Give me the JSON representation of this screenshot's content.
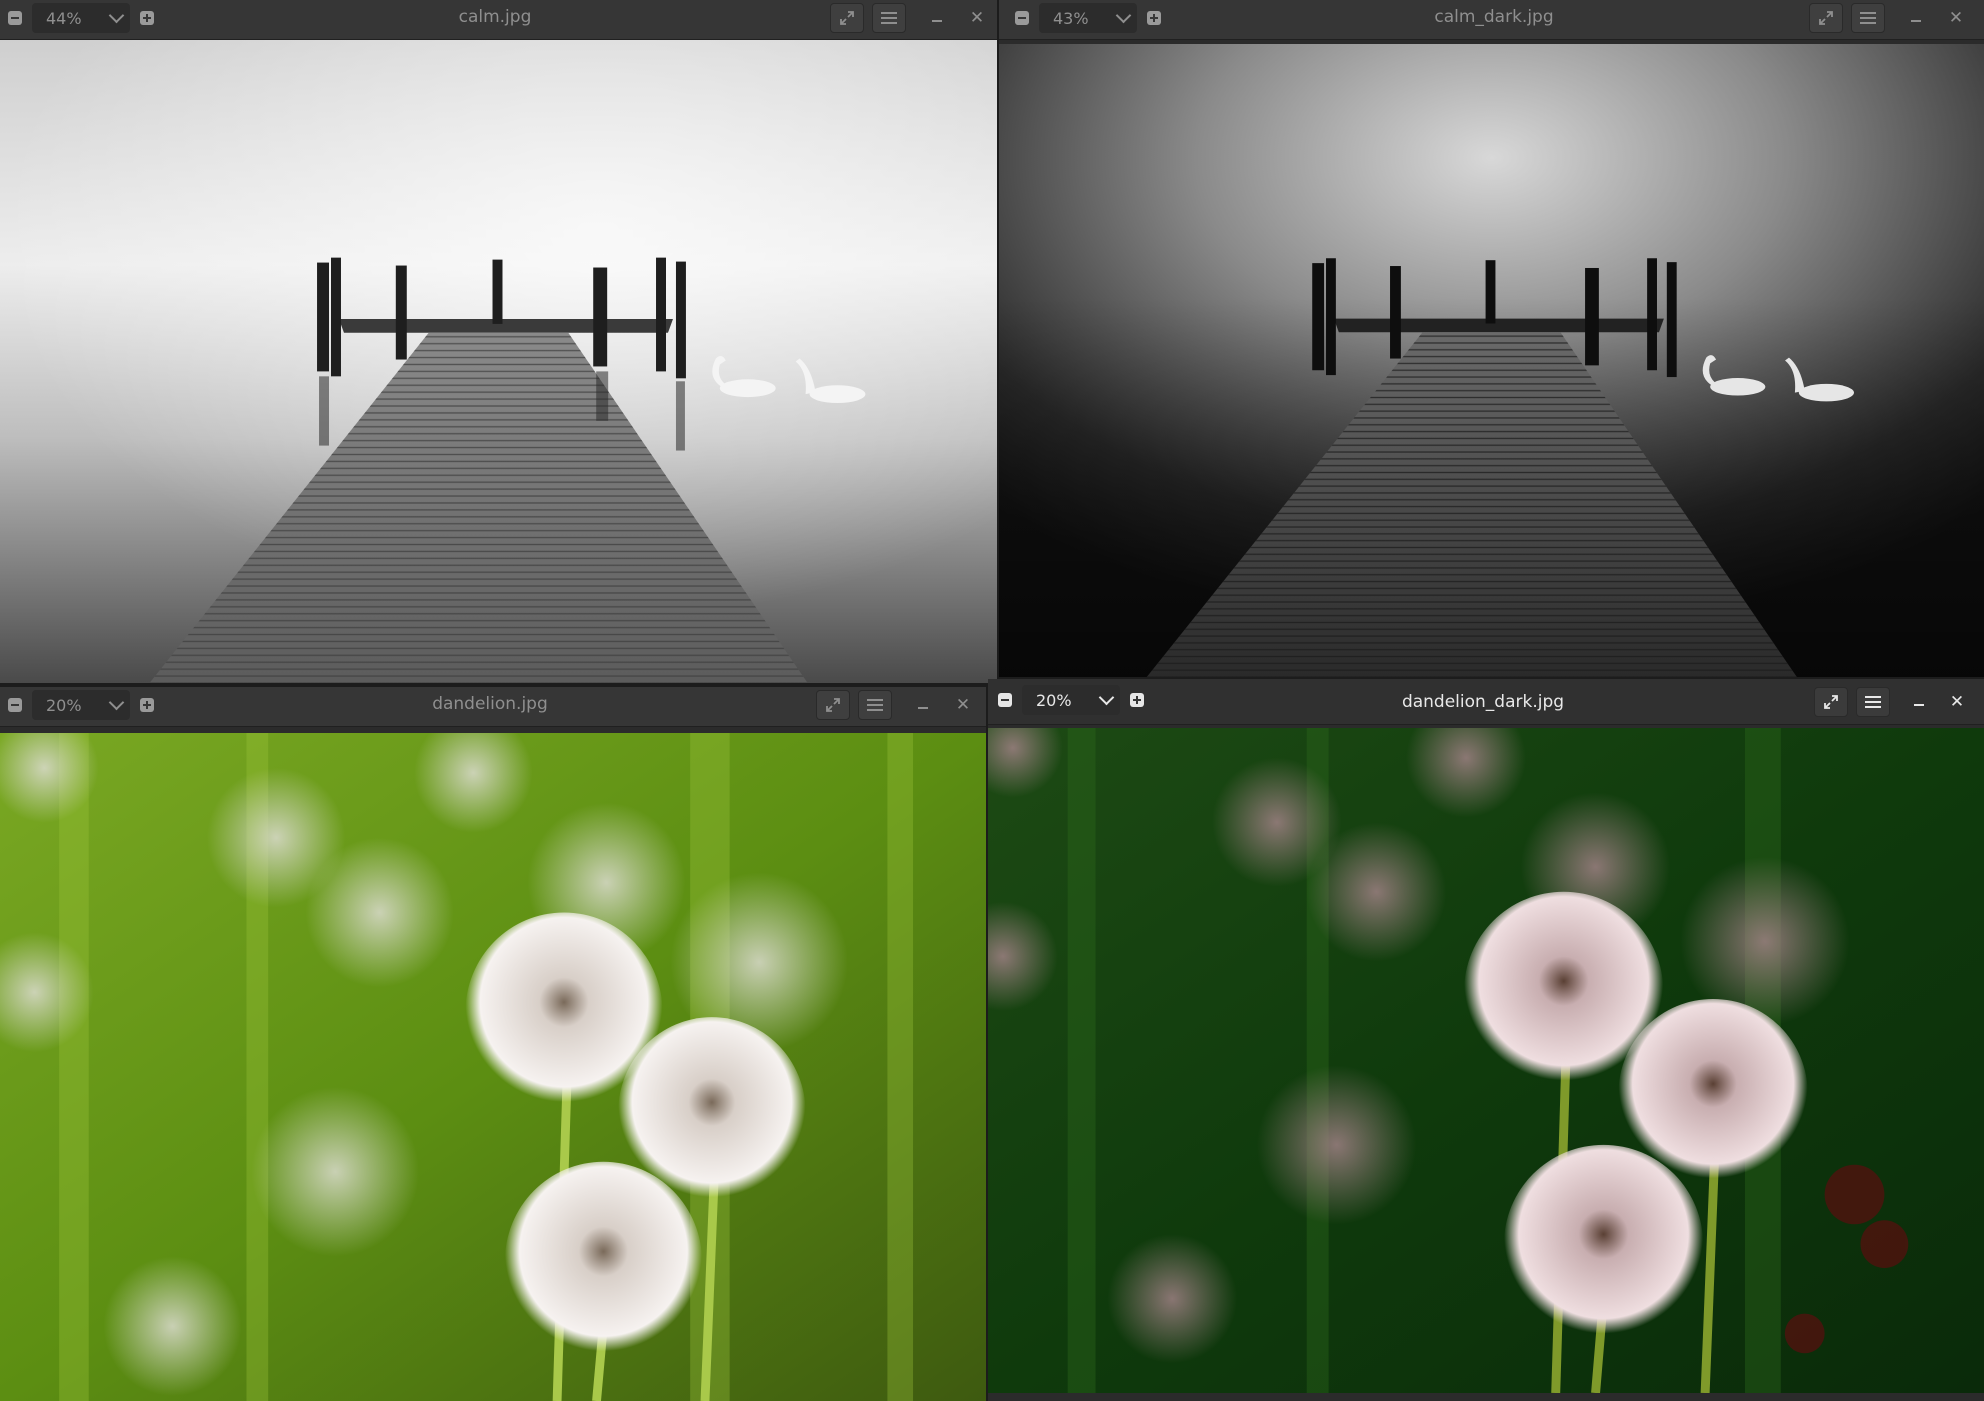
{
  "windows": {
    "calm": {
      "title": "calm.jpg",
      "zoom": "44%",
      "image": "black-and-white photo of a wooden pier extending into a misty lake with two swans"
    },
    "calm_dark": {
      "title": "calm_dark.jpg",
      "zoom": "43%",
      "image": "darkened black-and-white photo of a wooden pier in a misty lake with two swans"
    },
    "dandelion": {
      "title": "dandelion.jpg",
      "zoom": "20%",
      "image": "photo of white dandelion seed heads against a blurred bright green background"
    },
    "dandelion_dark": {
      "title": "dandelion_dark.jpg",
      "zoom": "20%",
      "image": "darker photo of pinkish dandelion seed heads against a deep green background"
    }
  },
  "colors": {
    "titlebar": "#363636",
    "titlebar_active": "#303030",
    "text_inactive": "#8f8f8f",
    "text_active": "#e8e8e8"
  },
  "icons": {
    "zoom_out": "minus-square-icon",
    "zoom_in": "plus-square-icon",
    "dropdown": "chevron-down-icon",
    "fullscreen": "expand-arrows-icon",
    "menu": "hamburger-menu-icon",
    "minimize": "minimize-icon",
    "close": "close-icon"
  }
}
